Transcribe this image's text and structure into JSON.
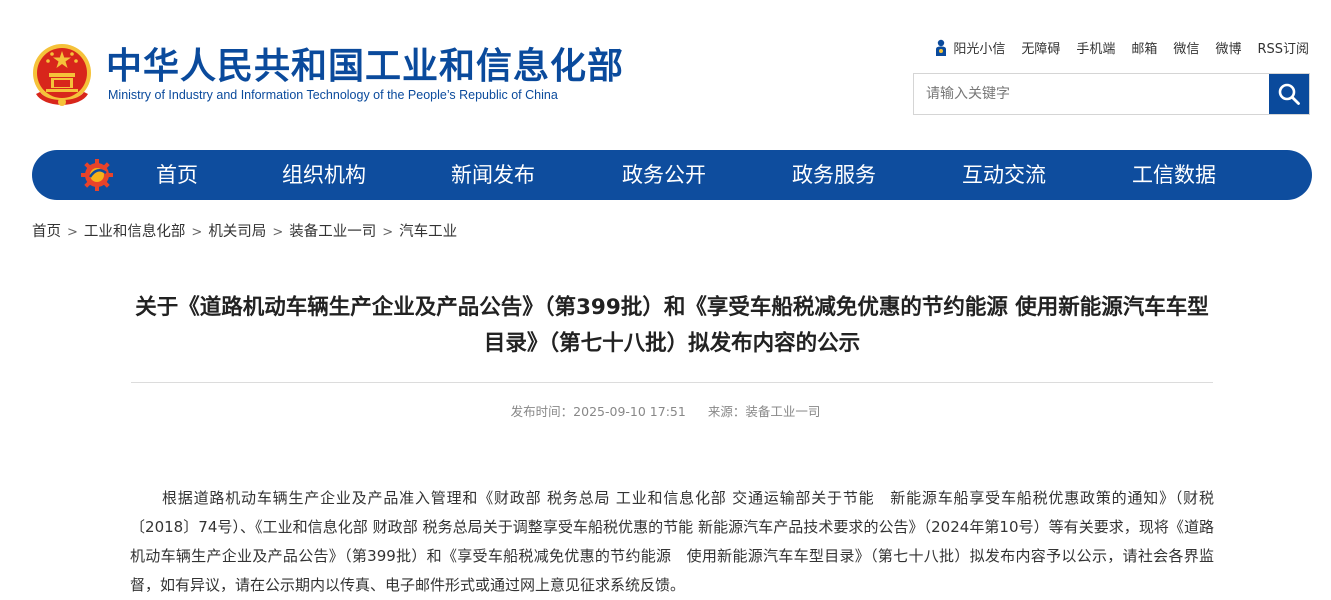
{
  "header": {
    "site_title": "中华人民共和国工业和信息化部",
    "site_subtitle": "Ministry of Industry and Information Technology of the People’s Republic of China",
    "top_links": {
      "sunshine": "阳光小信",
      "accessibility": "无障碍",
      "mobile": "手机端",
      "mail": "邮箱",
      "wechat": "微信",
      "weibo": "微博",
      "rss": "RSS订阅"
    },
    "search": {
      "placeholder": "请输入关键字"
    }
  },
  "nav": {
    "items": [
      "首页",
      "组织机构",
      "新闻发布",
      "政务公开",
      "政务服务",
      "互动交流",
      "工信数据"
    ]
  },
  "breadcrumb": [
    "首页",
    "工业和信息化部",
    "机关司局",
    "装备工业一司",
    "汽车工业"
  ],
  "article": {
    "title": "关于《道路机动车辆生产企业及产品公告》（第399批）和《享受车船税减免优惠的节约能源 使用新能源汽车车型目录》（第七十八批）拟发布内容的公示",
    "published_label": "发布时间：",
    "published_value": "2025-09-10 17:51",
    "source_label": "来源：",
    "source_value": "装备工业一司",
    "body": "根据道路机动车辆生产企业及产品准入管理和《财政部 税务总局 工业和信息化部 交通运输部关于节能　新能源车船享受车船税优惠政策的通知》（财税〔2018〕74号）、《工业和信息化部 财政部 税务总局关于调整享受车船税优惠的节能 新能源汽车产品技术要求的公告》（2024年第10号）等有关要求，现将《道路机动车辆生产企业及产品公告》（第399批）和《享受车船税减免优惠的节约能源　使用新能源汽车车型目录》（第七十八批）拟发布内容予以公示，请社会各界监督，如有异议，请在公示期内以传真、电子邮件形式或通过网上意见征求系统反馈。"
  },
  "colors": {
    "brand_blue": "#0a4a9c",
    "nav_blue": "#0e4d9e",
    "emblem_red": "#d8261b",
    "emblem_gold": "#f5c23a"
  },
  "icons": [
    "national-emblem-icon",
    "person-icon",
    "search-icon",
    "gear-logo-icon",
    "chevron-right-icon"
  ]
}
